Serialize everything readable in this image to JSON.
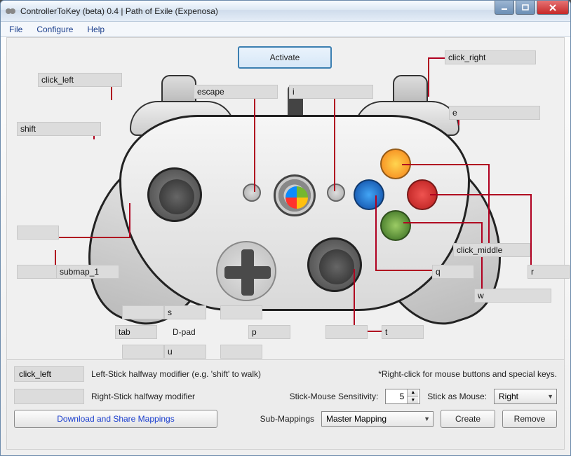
{
  "window": {
    "title": "ControllerToKey (beta) 0.4 | Path of Exile (Expenosa)"
  },
  "menu": {
    "file": "File",
    "configure": "Configure",
    "help": "Help"
  },
  "activate": "Activate",
  "mappings": {
    "lt": "click_left",
    "lb": "shift",
    "back": "escape",
    "start": "i",
    "rt": "click_right",
    "rb": "e",
    "ls_click": "",
    "ls_dir": "",
    "ls_label": "submap_1",
    "y": "click_middle",
    "b": "r",
    "a": "w",
    "x": "q",
    "rs_click": "",
    "rs_label": "t",
    "dpad_up": "s",
    "dpad_up_left": "",
    "dpad_left": "tab",
    "dpad_right": "p",
    "dpad_down_left": "",
    "dpad_down": "u",
    "dpad_label": "D-pad"
  },
  "bottom": {
    "left_mod_value": "click_left",
    "left_mod_label": "Left-Stick halfway modifier (e.g. 'shift' to walk)",
    "right_mod_value": "",
    "right_mod_label": "Right-Stick halfway modifier",
    "hint": "*Right-click for mouse buttons and special keys.",
    "sens_label": "Stick-Mouse Sensitivity:",
    "sens_value": "5",
    "stick_as_mouse_label": "Stick as Mouse:",
    "stick_as_mouse_value": "Right",
    "download": "Download and Share Mappings",
    "submappings_label": "Sub-Mappings",
    "submappings_value": "Master Mapping",
    "create": "Create",
    "remove": "Remove"
  }
}
